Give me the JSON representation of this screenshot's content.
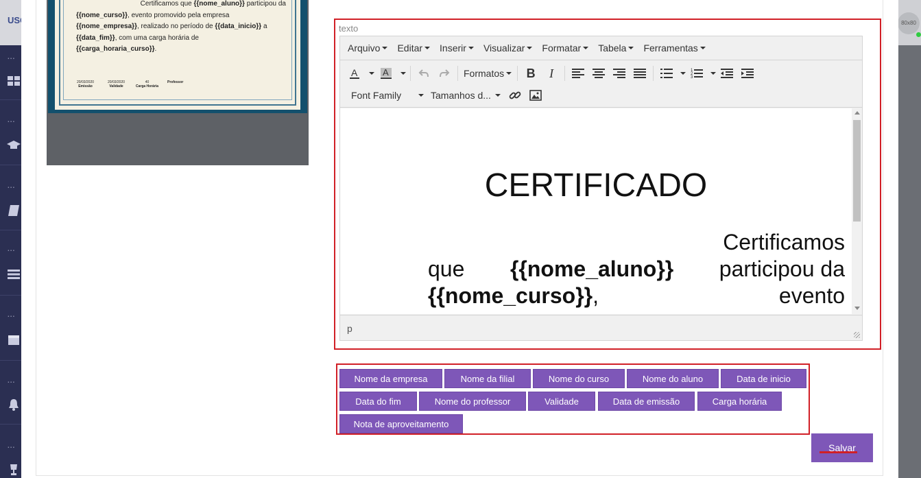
{
  "background": {
    "logo_text": "USO",
    "avatar_text": "80x80"
  },
  "preview": {
    "lines": [
      {
        "parts": [
          {
            "t": "Certificamos que ",
            "b": false
          },
          {
            "t": "{{nome_aluno}}",
            "b": true
          },
          {
            "t": " participou da",
            "b": false
          }
        ]
      },
      {
        "parts": [
          {
            "t": "{{nome_curso}}",
            "b": true
          },
          {
            "t": ", evento promovido pela empresa",
            "b": false
          }
        ]
      },
      {
        "parts": [
          {
            "t": "{{nome_empresa}}",
            "b": true
          },
          {
            "t": ", realizado no período de ",
            "b": false
          },
          {
            "t": "{{data_inicio}}",
            "b": true
          },
          {
            "t": " a",
            "b": false
          }
        ]
      },
      {
        "parts": [
          {
            "t": "{{data_fim}}",
            "b": true
          },
          {
            "t": ", com uma carga horária de",
            "b": false
          }
        ]
      },
      {
        "parts": [
          {
            "t": "{{carga_horaria_curso}}",
            "b": true
          },
          {
            "t": ".",
            "b": false
          }
        ]
      }
    ],
    "footer": [
      {
        "value": "20/03/2020",
        "label": "Emissão"
      },
      {
        "value": "20/03/2020",
        "label": "Validade"
      },
      {
        "value": "40",
        "label": "Carga Horária"
      },
      {
        "value": "",
        "label": "Professor"
      }
    ]
  },
  "editor": {
    "field_label": "texto",
    "menu": [
      "Arquivo",
      "Editar",
      "Inserir",
      "Visualizar",
      "Formatar",
      "Tabela",
      "Ferramentas"
    ],
    "toolbar": {
      "formats_label": "Formatos",
      "font_family_label": "Font Family",
      "font_size_label": "Tamanhos d..."
    },
    "content": {
      "title": "CERTIFICADO",
      "line1": "Certificamos",
      "line2_pre": "que",
      "line2_var": "{{nome_aluno}}",
      "line2_post": "participou da",
      "line3_var": "{{nome_curso}}",
      "line3_punct": ",",
      "line3_post": "evento"
    },
    "status_path": "p"
  },
  "variables": [
    "Nome da empresa",
    "Nome da filial",
    "Nome do curso",
    "Nome do aluno",
    "Data de inicio",
    "Data do fim",
    "Nome do professor",
    "Validade",
    "Data de emissão",
    "Carga horária",
    "Nota de aproveitamento"
  ],
  "save_label": "Salvar",
  "colors": {
    "accent": "#7e57b8",
    "highlight": "#d11f26"
  }
}
